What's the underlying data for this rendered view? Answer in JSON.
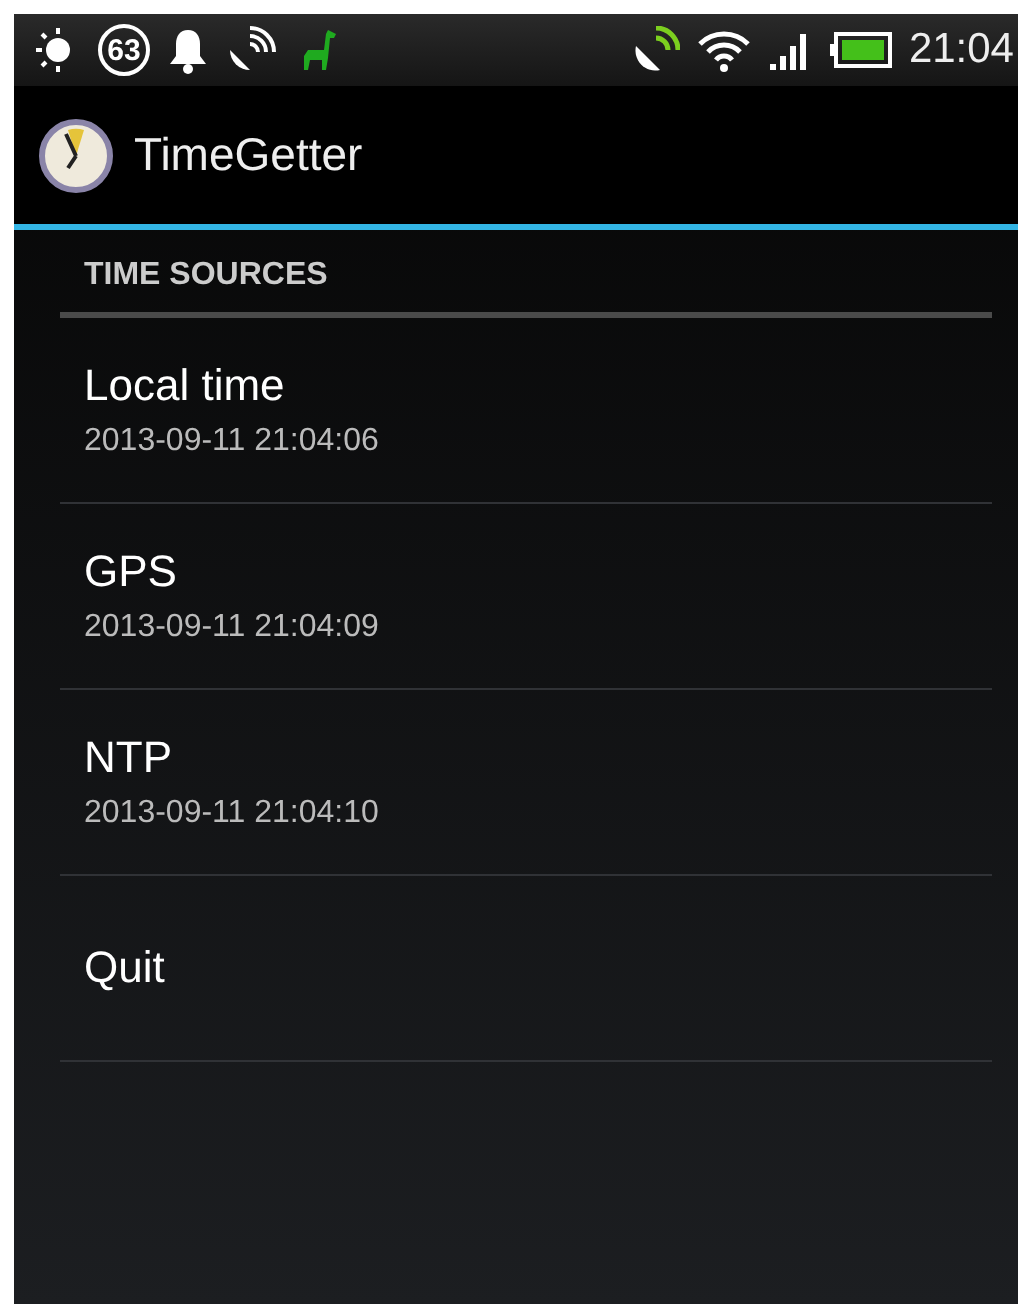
{
  "status_bar": {
    "badge": "63",
    "time": "21:04"
  },
  "action_bar": {
    "title": "TimeGetter"
  },
  "section": {
    "header": "TIME SOURCES"
  },
  "items": [
    {
      "kind": "source",
      "title": "Local time",
      "subtitle": "2013-09-11 21:04:06"
    },
    {
      "kind": "source",
      "title": "GPS",
      "subtitle": "2013-09-11 21:04:09"
    },
    {
      "kind": "source",
      "title": "NTP",
      "subtitle": "2013-09-11 21:04:10"
    },
    {
      "kind": "action",
      "title": "Quit"
    }
  ]
}
